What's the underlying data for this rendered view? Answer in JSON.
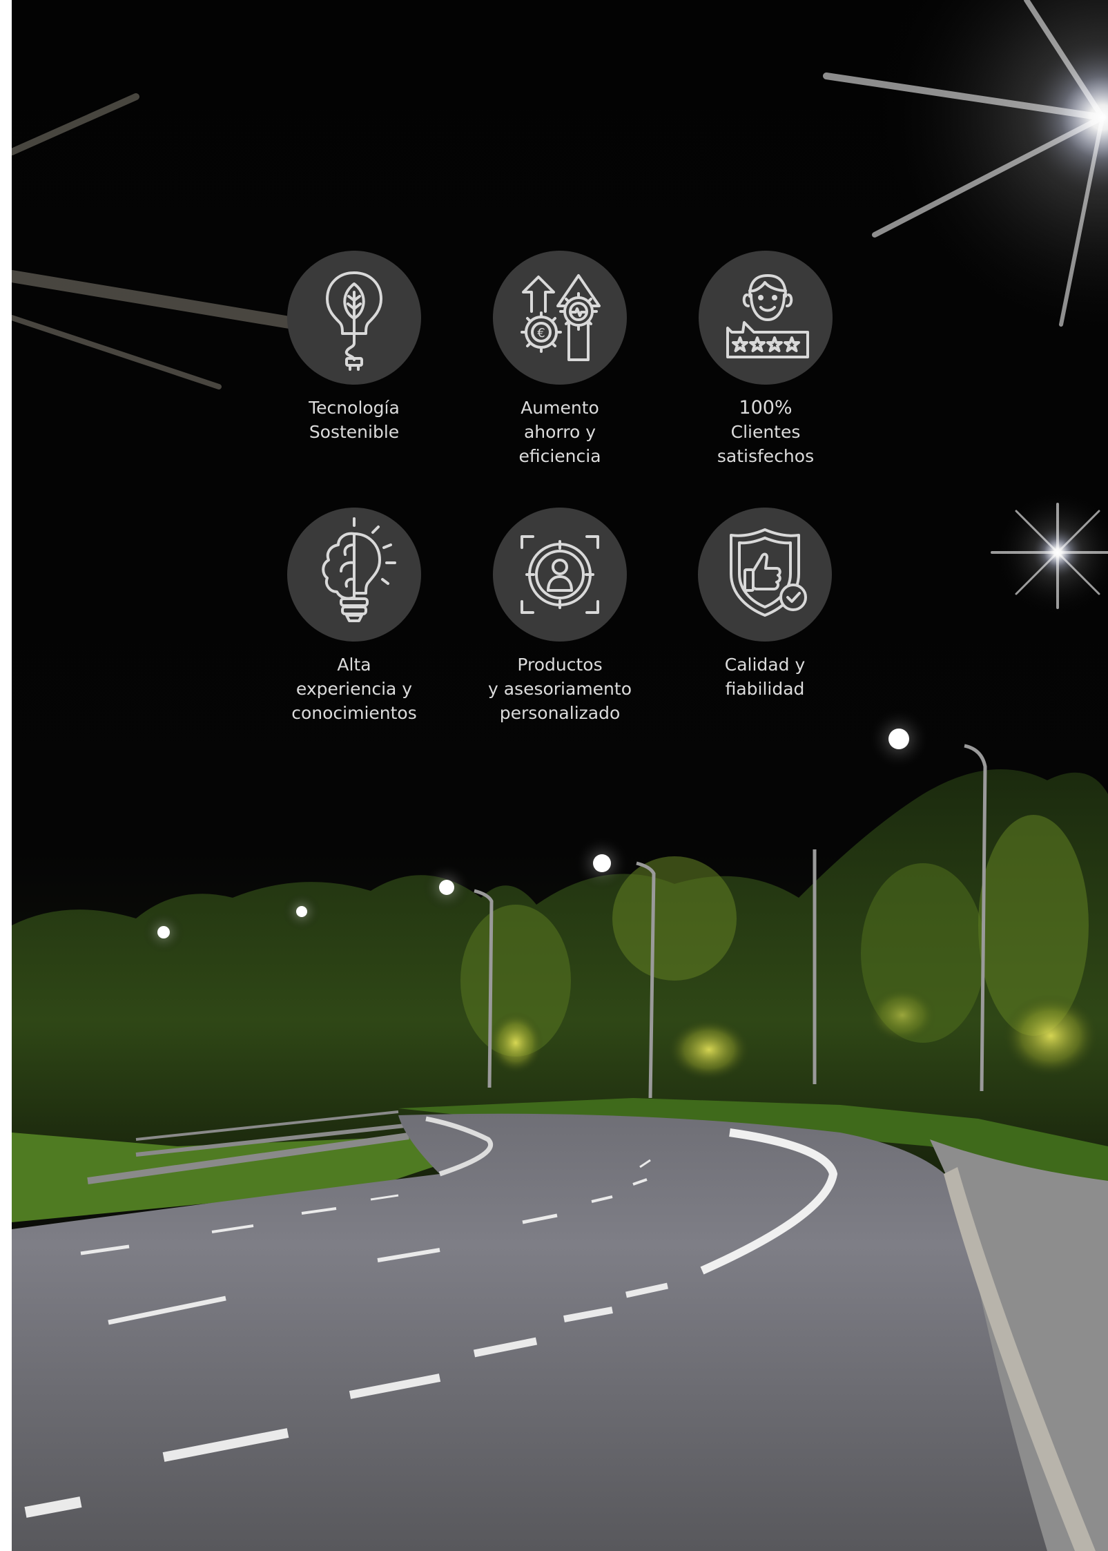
{
  "colors": {
    "circle_bg": "#3a3a3a",
    "icon_stroke": "#d9d9d9",
    "text": "#dcdcdc"
  },
  "features": [
    {
      "icon": "leaf-lightbulb-icon",
      "lines": [
        "Tecnología",
        "Sostenible"
      ]
    },
    {
      "icon": "growth-gears-icon",
      "lines": [
        "Aumento",
        "ahorro y",
        "eficiencia"
      ]
    },
    {
      "icon": "customer-rating-icon",
      "lines": [
        "100%",
        "Clientes",
        "satisfechos"
      ]
    },
    {
      "icon": "brain-lightbulb-icon",
      "lines": [
        "Alta",
        "experiencia y",
        "conocimientos"
      ]
    },
    {
      "icon": "user-target-icon",
      "lines": [
        "Productos",
        "y asesoriamento",
        "personalizado"
      ]
    },
    {
      "icon": "shield-thumbs-up-icon",
      "lines": [
        "Calidad y",
        "fiabilidad"
      ]
    }
  ]
}
